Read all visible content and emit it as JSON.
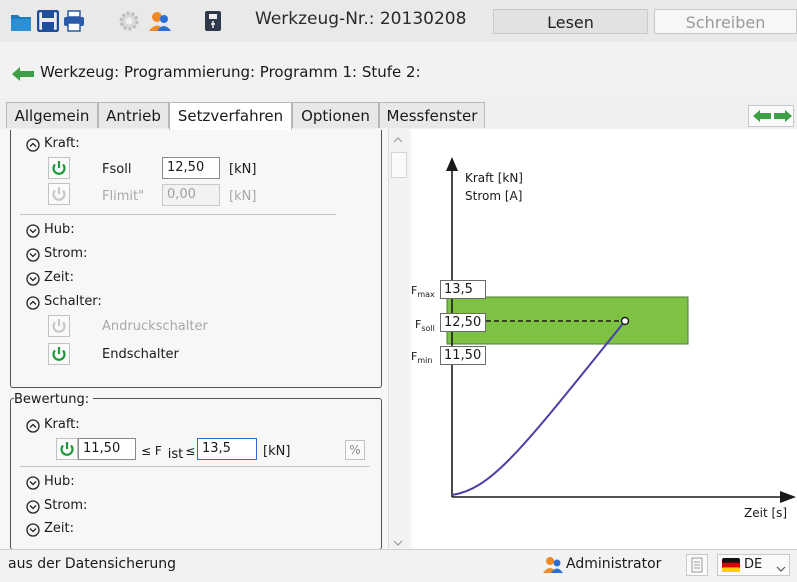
{
  "toolbar": {
    "title": "Werkzeug-Nr.: 20130208",
    "read_label": "Lesen",
    "write_label": "Schreiben",
    "icons": [
      "folder-icon",
      "save-icon",
      "print-icon",
      "settings-icon",
      "user-icon",
      "usb-icon"
    ]
  },
  "breadcrumb": {
    "text": "Werkzeug: Programmierung: Programm 1: Stufe 2:"
  },
  "tabs": [
    "Allgemein",
    "Antrieb",
    "Setzverfahren",
    "Optionen",
    "Messfenster"
  ],
  "active_tab": "Setzverfahren",
  "left": {
    "kraft": {
      "label": "Kraft:",
      "fsoll_label": "Fsoll",
      "fsoll_value": "12,50",
      "fsoll_unit": "[kN]",
      "flimit_label": "Flimit\"",
      "flimit_value": "0,00",
      "flimit_unit": "[kN]"
    },
    "hub_label": "Hub:",
    "strom_label": "Strom:",
    "zeit_label": "Zeit:",
    "schalter": {
      "label": "Schalter:",
      "andruck": "Andruckschalter",
      "endschalter": "Endschalter"
    },
    "bewertung": {
      "legend": "Bewertung:",
      "kraft_label": "Kraft:",
      "min_value": "11,50",
      "op1": "≤ F",
      "op_sub": "ist",
      "op2": "≤",
      "max_value": "13,5",
      "unit": "[kN]",
      "percent_label": "%",
      "hub_label": "Hub:",
      "strom_label": "Strom:",
      "zeit_label": "Zeit:"
    }
  },
  "chart": {
    "y_label_1": "Kraft [kN]",
    "y_label_2": "Strom [A]",
    "x_label": "Zeit [s]",
    "fmax_label": "F",
    "fmax_sub": "max",
    "fmax_value": "13,5",
    "fsoll_label": "F",
    "fsoll_sub": "soll",
    "fsoll_value": "12,50",
    "fmin_label": "F",
    "fmin_sub": "min",
    "fmin_value": "11,50",
    "colors": {
      "band": "#7dc243",
      "curve": "#4a3fa8",
      "axis": "#1a1a1a"
    }
  },
  "status": {
    "message": "aus der Datensicherung",
    "user": "Administrator",
    "language": "DE"
  }
}
